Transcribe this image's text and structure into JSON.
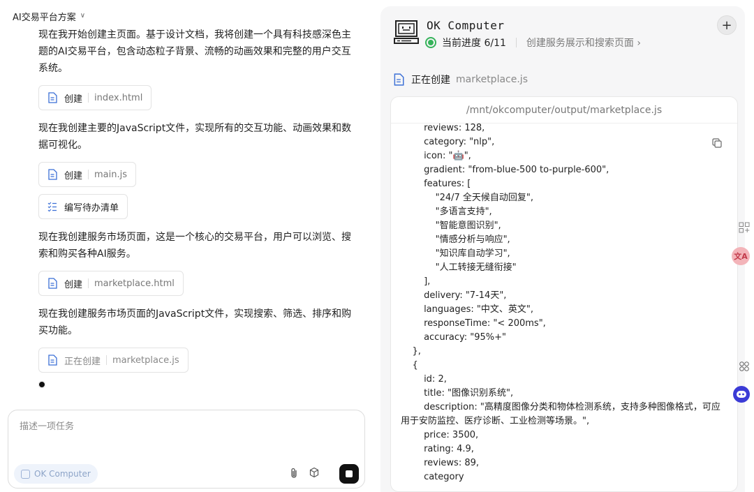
{
  "left": {
    "title": "AI交易平台方案",
    "messages": [
      {
        "text": "现在我开始创建主页面。基于设计文档，我将创建一个具有科技感深色主题的AI交易平台，包含动态粒子背景、流畅的动画效果和完整的用户交互系统。",
        "chip": {
          "action": "创建",
          "file": "index.html"
        }
      },
      {
        "text": "现在我创建主要的JavaScript文件，实现所有的交互功能、动画效果和数据可视化。",
        "chip": {
          "action": "创建",
          "file": "main.js"
        }
      },
      {
        "todo": "编写待办清单"
      },
      {
        "text": "现在我创建服务市场页面，这是一个核心的交易平台，用户可以浏览、搜索和购买各种AI服务。",
        "chip": {
          "action": "创建",
          "file": "marketplace.html"
        }
      },
      {
        "text": "现在我创建服务市场页面的JavaScript文件，实现搜索、筛选、排序和购买功能。",
        "chip": {
          "action": "正在创建",
          "file": "marketplace.js"
        }
      }
    ],
    "composer": {
      "placeholder": "描述一项任务",
      "mode_label": "OK Computer"
    }
  },
  "right": {
    "computer_name": "OK Computer",
    "progress_label": "当前进度 6/11",
    "progress_step": "创建服务展示和搜索页面",
    "status_action": "正在创建",
    "status_file": "marketplace.js",
    "file_path": "/mnt/okcomputer/output/marketplace.js",
    "code_lines": [
      "        reviews: 128,",
      "        category: \"nlp\",",
      "        icon: \"🤖\",",
      "        gradient: \"from-blue-500 to-purple-600\",",
      "        features: [",
      "            \"24/7 全天候自动回复\",",
      "            \"多语言支持\",",
      "            \"智能意图识别\",",
      "            \"情感分析与响应\",",
      "            \"知识库自动学习\",",
      "            \"人工转接无缝衔接\"",
      "        ],",
      "        delivery: \"7-14天\",",
      "        languages: \"中文、英文\",",
      "        responseTime: \"< 200ms\",",
      "        accuracy: \"95%+\"",
      "    },",
      "    {",
      "        id: 2,",
      "        title: \"图像识别系统\",",
      "        description: \"高精度图像分类和物体检测系统，支持多种图像格式，可应用于安防监控、医疗诊断、工业检测等场景。\",",
      "        price: 3500,",
      "        rating: 4.9,",
      "        reviews: 89,",
      "        category"
    ]
  },
  "colors": {
    "accent_green": "#36b35b",
    "stop_button": "#111111",
    "file_icon_blue": "#3b6fd6"
  }
}
